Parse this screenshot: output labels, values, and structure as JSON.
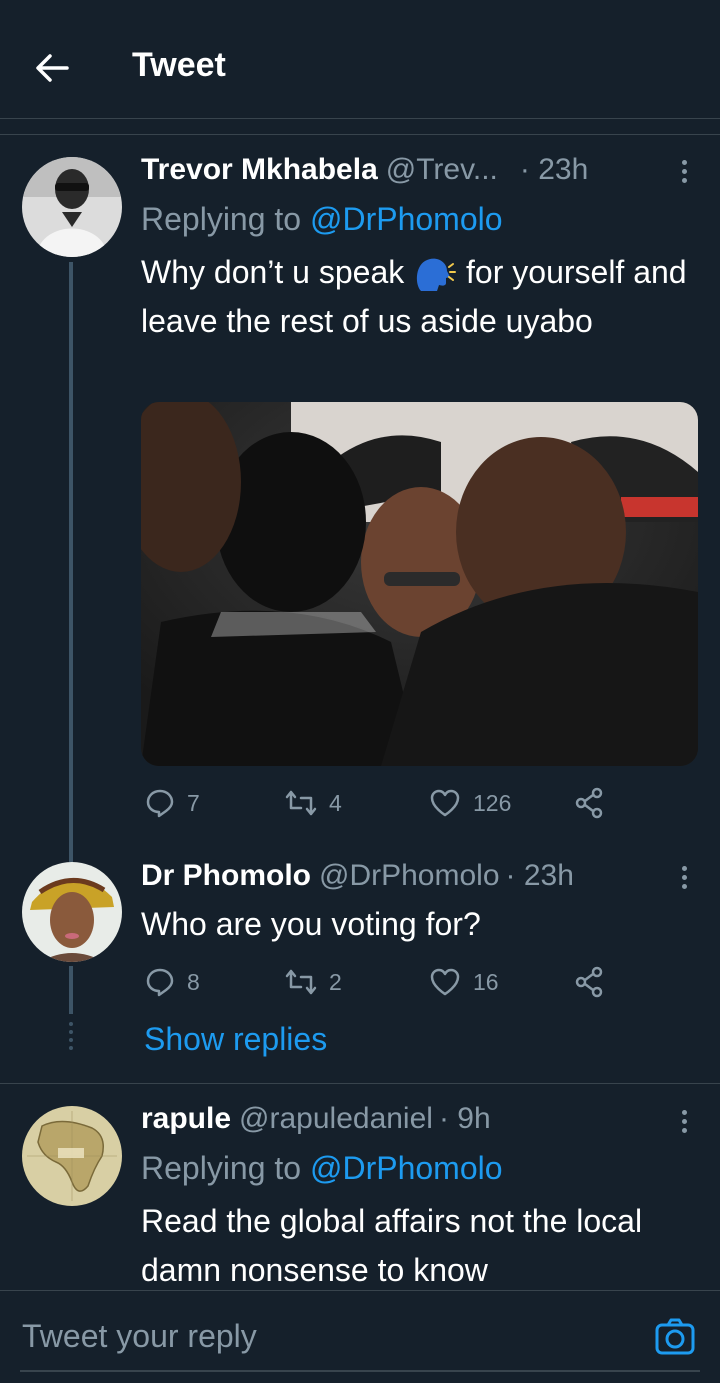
{
  "header": {
    "title": "Tweet"
  },
  "tweets": [
    {
      "name": "Trevor Mkhabela",
      "handle": "@Trev...",
      "time": "· 23h",
      "replying_prefix": "Replying to ",
      "replying_to": "@DrPhomolo",
      "text_part1": "Why don’t u speak",
      "text_part2": "for yourself and leave the rest of us aside uyabo",
      "stats": {
        "replies": "7",
        "retweets": "4",
        "likes": "126"
      }
    },
    {
      "name": "Dr Phomolo",
      "handle": "@DrPhomolo",
      "time": "· 23h",
      "text": "Who are you voting for?",
      "stats": {
        "replies": "8",
        "retweets": "2",
        "likes": "16"
      },
      "show_replies": "Show replies"
    },
    {
      "name": "rapule",
      "handle": "@rapuledaniel",
      "time": "· 9h",
      "replying_prefix": "Replying to ",
      "replying_to": "@DrPhomolo",
      "text": "Read the global affairs not the local damn nonsense to know"
    }
  ],
  "reply_box": {
    "placeholder": "Tweet your reply"
  },
  "colors": {
    "background": "#15202b",
    "accent": "#1d9bf0",
    "muted": "#8899a6",
    "border": "#38444d"
  }
}
